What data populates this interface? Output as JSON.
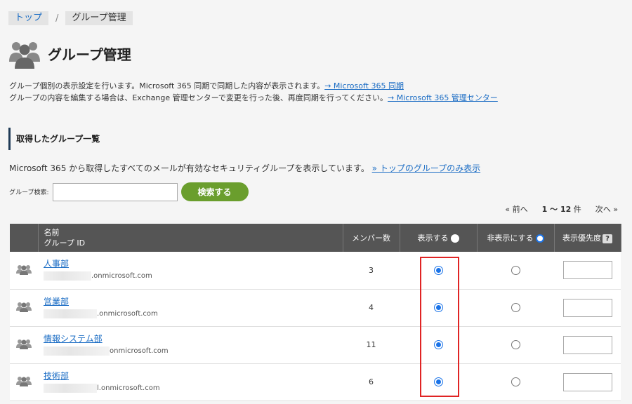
{
  "breadcrumb": {
    "home": "トップ",
    "separator": "/",
    "current": "グループ管理"
  },
  "page": {
    "title": "グループ管理",
    "icon": "group-users-icon"
  },
  "description": {
    "line1": "グループ個別の表示設定を行います。Microsoft 365 同期で同期した内容が表示されます。",
    "line1_link": "→ Microsoft 365 同期",
    "line2": "グループの内容を編集する場合は、Exchange 管理センターで変更を行った後、再度同期を行ってください。",
    "line2_link": "→ Microsoft 365 管理センター"
  },
  "section": {
    "title": "取得したグループ一覧"
  },
  "list": {
    "description": "Microsoft 365 から取得したすべてのメールが有効なセキュリティグループを表示しています。",
    "link": "» トップのグループのみ表示"
  },
  "search": {
    "label": "グループ検索:",
    "value": "",
    "button": "検索する"
  },
  "pager": {
    "prev": "« 前へ",
    "range": "1 〜 12",
    "unit": "件",
    "next": "次へ »"
  },
  "table": {
    "headers": {
      "name": "名前",
      "group_id": "グループ ID",
      "members": "メンバー数",
      "show": "表示する",
      "hide": "非表示にする",
      "priority": "表示優先度",
      "help": "?"
    },
    "rows": [
      {
        "name": "人事部",
        "id_suffix": ".onmicrosoft.com",
        "members": "3",
        "show": true
      },
      {
        "name": "営業部",
        "id_suffix": ".onmicrosoft.com",
        "members": "4",
        "show": true
      },
      {
        "name": "情報システム部",
        "id_suffix": "onmicrosoft.com",
        "members": "11",
        "show": true
      },
      {
        "name": "技術部",
        "id_suffix": "l.onmicrosoft.com",
        "members": "6",
        "show": true
      }
    ]
  },
  "colors": {
    "header_bg": "#555555",
    "button_green": "#6a9e2d",
    "link": "#1a6cc4",
    "radio_blue": "#1a73e8",
    "highlight": "#e02424"
  }
}
